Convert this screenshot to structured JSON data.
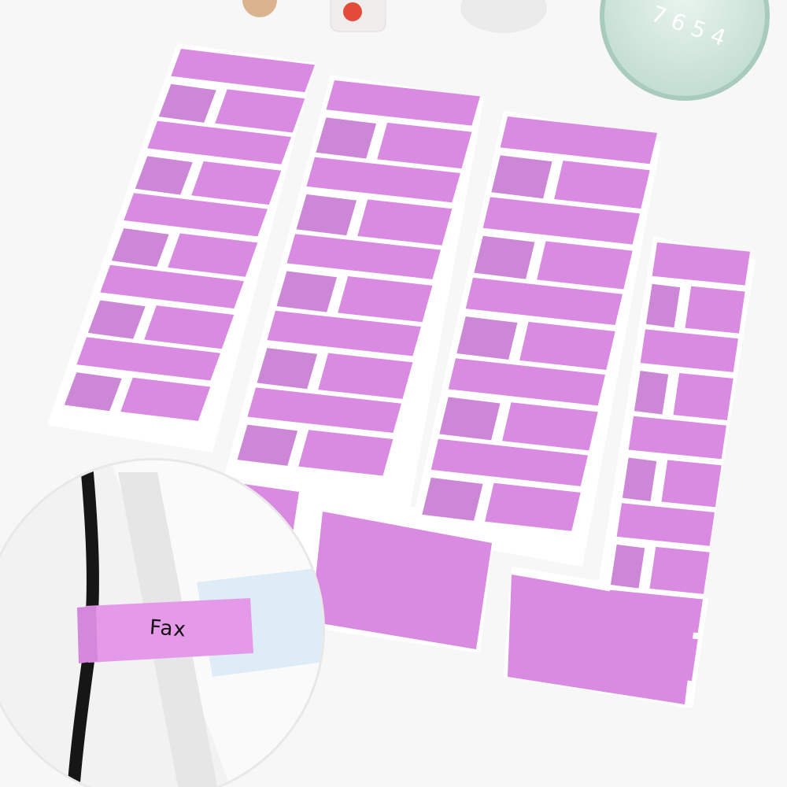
{
  "photo": {
    "subject": "purple-cable-label-sheets",
    "background_color": "#f7f7f7",
    "sheet_color": "#ffffff",
    "label_color": "#d88be0",
    "label_shadow_color": "#c77bd2",
    "clock_color": "#cfe6da",
    "clock_digits": "7 6 5 4"
  },
  "inset": {
    "label_text": "Fax",
    "cable_color": "#161616",
    "label_color": "#e59ae9"
  }
}
